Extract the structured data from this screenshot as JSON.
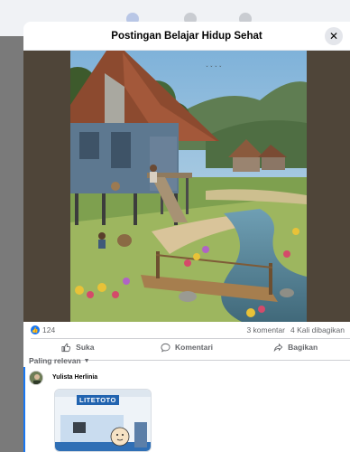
{
  "modal": {
    "title": "Postingan Belajar Hidup Sehat"
  },
  "stats": {
    "likes": "124",
    "comments": "3 komentar",
    "shares": "4 Kali dibagikan"
  },
  "actions": {
    "like": "Suka",
    "comment": "Komentari",
    "share": "Bagikan"
  },
  "sort": {
    "label": "Paling relevan"
  },
  "comment": {
    "author": "Yulista Herlinia",
    "image_text": "LITETOTO"
  },
  "colors": {
    "accent": "#1877f2",
    "photo_bg": "#4f4539"
  }
}
